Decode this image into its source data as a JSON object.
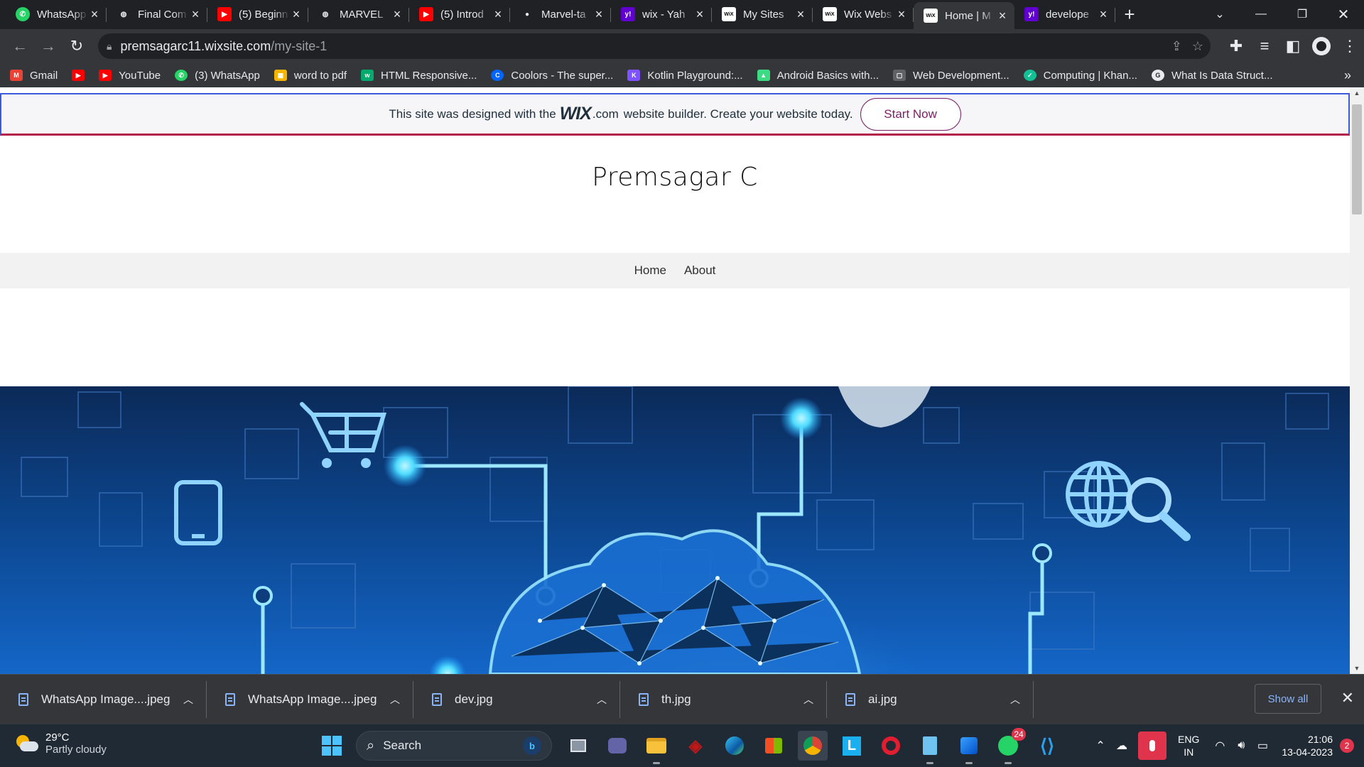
{
  "browser": {
    "tabs": [
      {
        "title": "WhatsApp",
        "icon": "whatsapp-icon",
        "color": "#25d366",
        "glyph": "✆"
      },
      {
        "title": "Final Com",
        "icon": "globe-icon",
        "color": "#5f6368",
        "glyph": "◍"
      },
      {
        "title": "(5) Beginn",
        "icon": "youtube-icon",
        "color": "#ff0000",
        "glyph": "▶"
      },
      {
        "title": "MARVEL",
        "icon": "globe-icon",
        "color": "#5f6368",
        "glyph": "◍"
      },
      {
        "title": "(5) Introd",
        "icon": "youtube-icon",
        "color": "#ff0000",
        "glyph": "▶"
      },
      {
        "title": "Marvel-ta",
        "icon": "github-icon",
        "color": "#3c3c3c",
        "glyph": "●"
      },
      {
        "title": "wix - Yah",
        "icon": "yahoo-icon",
        "color": "#6001d2",
        "glyph": "y!"
      },
      {
        "title": "My Sites",
        "icon": "wix-icon",
        "color": "#ffffff",
        "glyph": "WiX"
      },
      {
        "title": "Wix Webs",
        "icon": "wix-icon",
        "color": "#ffffff",
        "glyph": "WiX"
      },
      {
        "title": "Home | M",
        "icon": "wix-icon",
        "color": "#ffffff",
        "glyph": "WiX",
        "active": true
      },
      {
        "title": "develope",
        "icon": "yahoo-icon",
        "color": "#6001d2",
        "glyph": "y!"
      }
    ],
    "url_host": "premsagarc11.wixsite.com",
    "url_path": "/my-site-1",
    "bookmarks": [
      {
        "label": "Gmail",
        "icon": "gmail-icon",
        "color": "#ea4335",
        "glyph": "M"
      },
      {
        "label": "",
        "icon": "youtube-icon",
        "color": "#ff0000",
        "glyph": "▶"
      },
      {
        "label": "YouTube",
        "icon": "youtube-icon",
        "color": "#ff0000",
        "glyph": "▶"
      },
      {
        "label": "(3) WhatsApp",
        "icon": "whatsapp-icon",
        "color": "#25d366",
        "glyph": "✆"
      },
      {
        "label": "word to pdf",
        "icon": "grid-icon",
        "color": "#f4b400",
        "glyph": "▦"
      },
      {
        "label": "HTML Responsive...",
        "icon": "w3-icon",
        "color": "#04aa6d",
        "glyph": "w"
      },
      {
        "label": "Coolors - The super...",
        "icon": "coolors-icon",
        "color": "#0066ff",
        "glyph": "C"
      },
      {
        "label": "Kotlin Playground:...",
        "icon": "kotlin-icon",
        "color": "#7f52ff",
        "glyph": "K"
      },
      {
        "label": "Android Basics with...",
        "icon": "android-icon",
        "color": "#3ddc84",
        "glyph": "▲"
      },
      {
        "label": "Web Development...",
        "icon": "doc-icon",
        "color": "#5f6368",
        "glyph": "▢"
      },
      {
        "label": "Computing | Khan...",
        "icon": "khan-icon",
        "color": "#14bf96",
        "glyph": "✓"
      },
      {
        "label": "What Is Data Struct...",
        "icon": "g-icon",
        "color": "#e8eaed",
        "glyph": "G"
      }
    ]
  },
  "page": {
    "banner_prefix": "This site was designed with the",
    "banner_logo": "WIX",
    "banner_dotcom": ".com",
    "banner_suffix": "website builder. Create your website today.",
    "banner_cta": "Start Now",
    "site_title": "Premsagar C",
    "nav": [
      "Home",
      "About"
    ]
  },
  "downloads": {
    "items": [
      "WhatsApp Image....jpeg",
      "WhatsApp Image....jpeg",
      "dev.jpg",
      "th.jpg",
      "ai.jpg"
    ],
    "show_all": "Show all"
  },
  "taskbar": {
    "weather_temp": "29°C",
    "weather_desc": "Partly cloudy",
    "search": "Search",
    "whatsapp_badge": "24",
    "lang_1": "ENG",
    "lang_2": "IN",
    "time": "21:06",
    "date": "13-04-2023",
    "notifications": "2"
  }
}
